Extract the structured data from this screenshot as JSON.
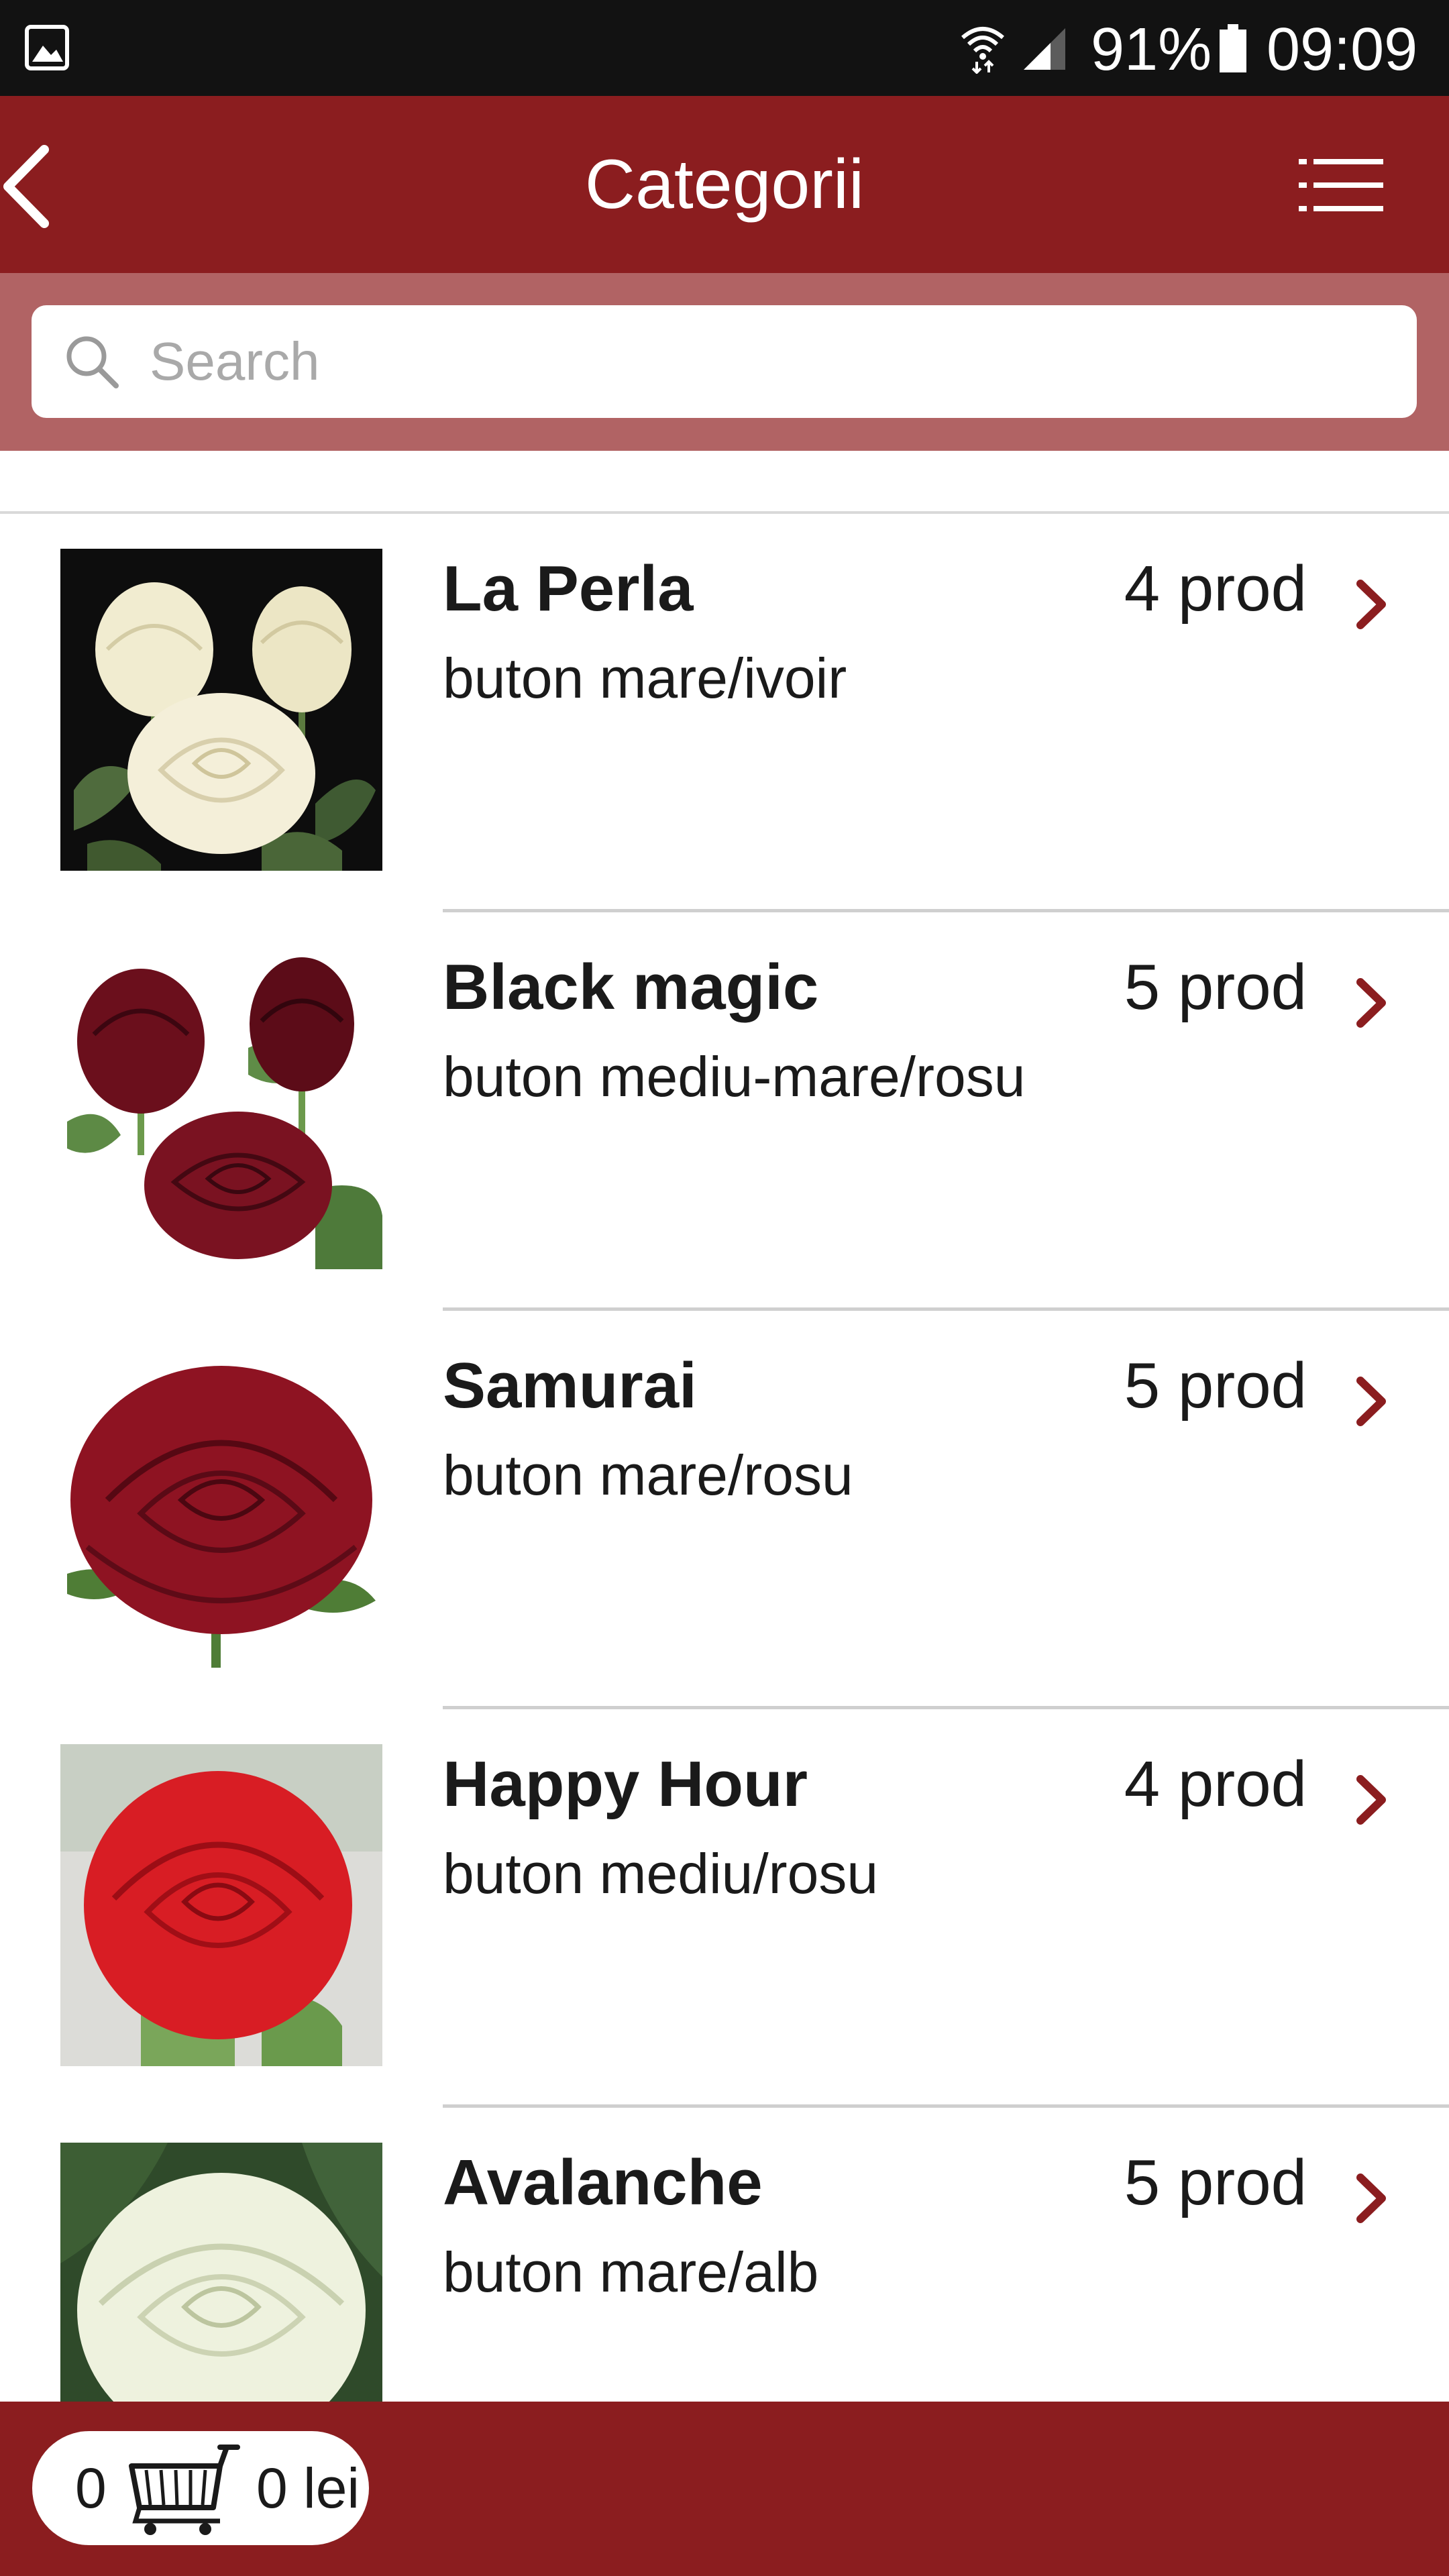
{
  "status_bar": {
    "battery_percent": "91%",
    "time": "09:09",
    "icons": [
      "gallery-icon",
      "wifi-icon",
      "signal-icon",
      "battery-icon"
    ]
  },
  "header": {
    "title": "Categorii",
    "icons": [
      "back-arrow-icon",
      "list-menu-icon"
    ]
  },
  "search": {
    "placeholder": "Search",
    "value": ""
  },
  "categories": [
    {
      "name": "La Perla",
      "description": "buton mare/ivoir",
      "count": "4 prod"
    },
    {
      "name": "Black magic",
      "description": "buton mediu-mare/rosu",
      "count": "5 prod"
    },
    {
      "name": "Samurai",
      "description": "buton mare/rosu",
      "count": "5 prod"
    },
    {
      "name": "Happy Hour",
      "description": "buton mediu/rosu",
      "count": "4 prod"
    },
    {
      "name": "Avalanche",
      "description": "buton mare/alb",
      "count": "5 prod"
    }
  ],
  "cart": {
    "quantity": "0",
    "total": "0 lei"
  },
  "colors": {
    "brand": "#8b1d1f",
    "search_band": "#b16364",
    "chevron": "#8b1d1f",
    "status_bar": "#121212"
  }
}
